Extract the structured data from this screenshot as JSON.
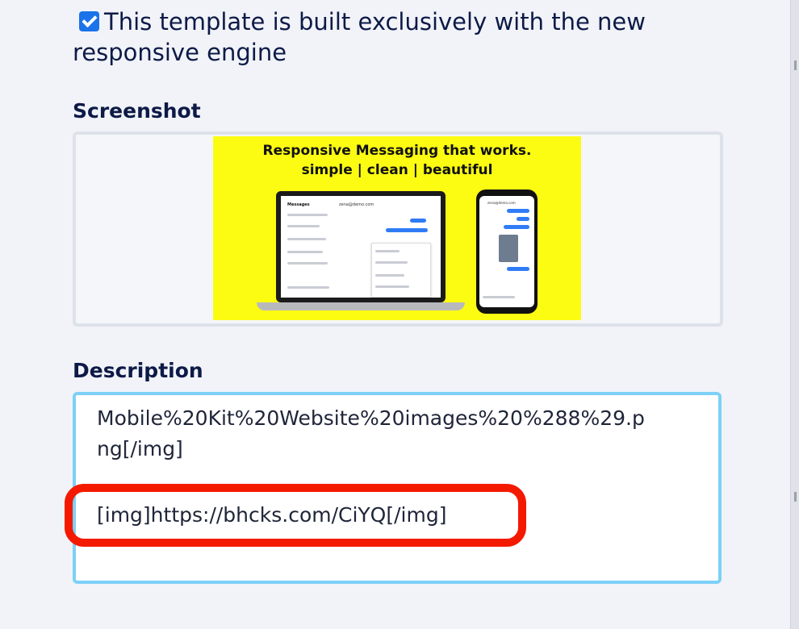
{
  "checkbox": {
    "checked": true,
    "label": "This template is built exclusively with the new responsive engine",
    "line1": "This template is built exclusively with the new",
    "line2": "responsive engine"
  },
  "screenshot": {
    "heading": "Screenshot",
    "promo_line1": "Responsive Messaging that works.",
    "promo_line2": "simple | clean | beautiful",
    "laptop_header": "Messages",
    "laptop_contact": "zena@demo.com",
    "phone_contact": "zena@demo.com"
  },
  "description": {
    "heading": "Description",
    "line1": "Mobile%20Kit%20Website%20images%20%288%29.p",
    "line2": "ng[/img]",
    "line3": "[img]https://bhcks.com/CiYQ[/img]"
  },
  "colors": {
    "accent": "#1a73e8",
    "highlight": "#f41a00",
    "focus_border": "#7ed0f7",
    "promo_bg": "#fcfc13"
  }
}
